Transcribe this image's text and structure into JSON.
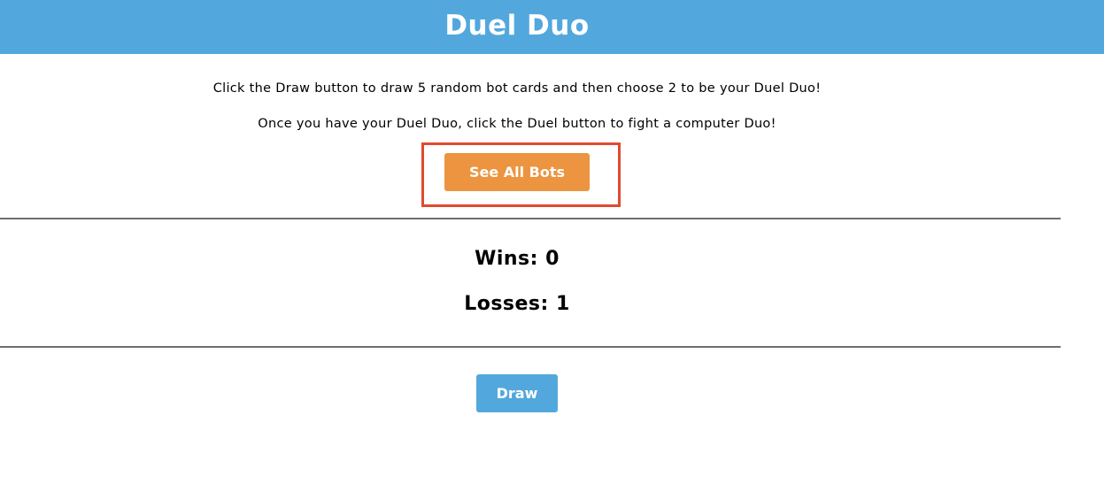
{
  "header": {
    "title": "Duel Duo"
  },
  "instructions": {
    "line1": "Click the Draw button to draw 5 random bot cards and then choose 2 to be your Duel Duo!",
    "line2": "Once you have your Duel Duo, click the Duel button to fight a computer Duo!"
  },
  "buttons": {
    "see_all_bots": "See All Bots",
    "draw": "Draw"
  },
  "score": {
    "wins_text": "Wins: 0",
    "losses_text": "Losses: 1"
  },
  "colors": {
    "header_bg": "#52a8dd",
    "see_all_button": "#ec943f",
    "draw_button": "#52a8dd",
    "highlight_border": "#e04a2f"
  }
}
